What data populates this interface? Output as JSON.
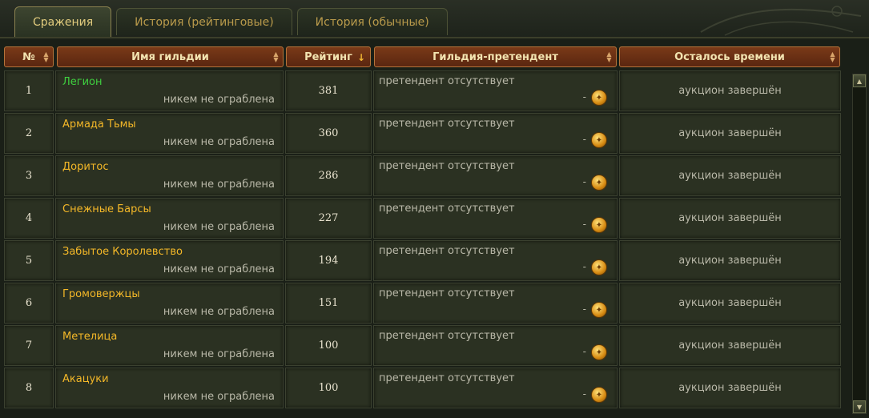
{
  "tabs": [
    {
      "label": "Сражения",
      "active": true
    },
    {
      "label": "История (рейтинговые)",
      "active": false
    },
    {
      "label": "История (обычные)",
      "active": false
    }
  ],
  "columns": {
    "num": "№",
    "guild": "Имя гильдии",
    "rating": "Рейтинг",
    "claimant": "Гильдия-претендент",
    "time_left": "Осталось времени"
  },
  "rows": [
    {
      "num": "1",
      "guild": "Легион",
      "guild_color": "#3fd03f",
      "status": "никем не ограблена",
      "rating": "381",
      "claimant": "претендент отсутствует",
      "dash": "-",
      "time_left": "аукцион завершён"
    },
    {
      "num": "2",
      "guild": "Армада Тьмы",
      "guild_color": "#f4b828",
      "status": "никем не ограблена",
      "rating": "360",
      "claimant": "претендент отсутствует",
      "dash": "-",
      "time_left": "аукцион завершён"
    },
    {
      "num": "3",
      "guild": "Доритос",
      "guild_color": "#f4b828",
      "status": "никем не ограблена",
      "rating": "286",
      "claimant": "претендент отсутствует",
      "dash": "-",
      "time_left": "аукцион завершён"
    },
    {
      "num": "4",
      "guild": "Снежные Барсы",
      "guild_color": "#f4b828",
      "status": "никем не ограблена",
      "rating": "227",
      "claimant": "претендент отсутствует",
      "dash": "-",
      "time_left": "аукцион завершён"
    },
    {
      "num": "5",
      "guild": "Забытое Королевство",
      "guild_color": "#f4b828",
      "status": "никем не ограблена",
      "rating": "194",
      "claimant": "претендент отсутствует",
      "dash": "-",
      "time_left": "аукцион завершён"
    },
    {
      "num": "6",
      "guild": "Громовержцы",
      "guild_color": "#f4b828",
      "status": "никем не ограблена",
      "rating": "151",
      "claimant": "претендент отсутствует",
      "dash": "-",
      "time_left": "аукцион завершён"
    },
    {
      "num": "7",
      "guild": "Метелица",
      "guild_color": "#f4b828",
      "status": "никем не ограблена",
      "rating": "100",
      "claimant": "претендент отсутствует",
      "dash": "-",
      "time_left": "аукцион завершён"
    },
    {
      "num": "8",
      "guild": "Акацуки",
      "guild_color": "#f4b828",
      "status": "никем не ограблена",
      "rating": "100",
      "claimant": "претендент отсутствует",
      "dash": "-",
      "time_left": "аукцион завершён"
    }
  ],
  "icons": {
    "coin": "gold-coin-icon",
    "sort": "sort-arrows-icon",
    "sort_active": "sort-desc-arrow-icon"
  },
  "colors": {
    "accent": "#f4b828",
    "header_bg": "#6a3014",
    "row_bg": "#2b3122",
    "green_guild": "#3fd03f"
  }
}
